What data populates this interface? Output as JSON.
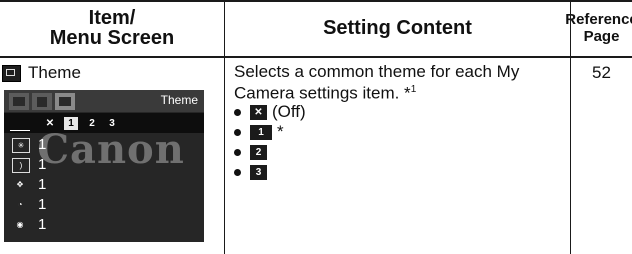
{
  "headers": {
    "item_line1": "Item/",
    "item_line2": "Menu Screen",
    "setting": "Setting Content",
    "ref_line1": "Reference",
    "ref_line2": "Page"
  },
  "row": {
    "item_title": "Theme",
    "description": "Selects a common theme for each My Camera settings item. *",
    "description_footnote": "1",
    "bullets": [
      {
        "icon_label": "",
        "text": "(Off)"
      },
      {
        "icon_label": "1",
        "text": "*"
      },
      {
        "icon_label": "2",
        "text": ""
      },
      {
        "icon_label": "3",
        "text": ""
      }
    ],
    "reference_page": "52"
  },
  "camera_screen": {
    "title": "Theme",
    "watermark": "Canon",
    "options": [
      "",
      "1",
      "2",
      "3"
    ],
    "rows": [
      {
        "icon": "start-image-icon",
        "value": "1"
      },
      {
        "icon": "startup-sound-icon",
        "value": "1"
      },
      {
        "icon": "operation-sound-icon",
        "value": "1"
      },
      {
        "icon": "selftimer-sound-icon",
        "value": "1"
      },
      {
        "icon": "shutter-sound-icon",
        "value": "1"
      }
    ]
  },
  "colors": {
    "screen_bg": "#262626",
    "text": "#111111"
  }
}
